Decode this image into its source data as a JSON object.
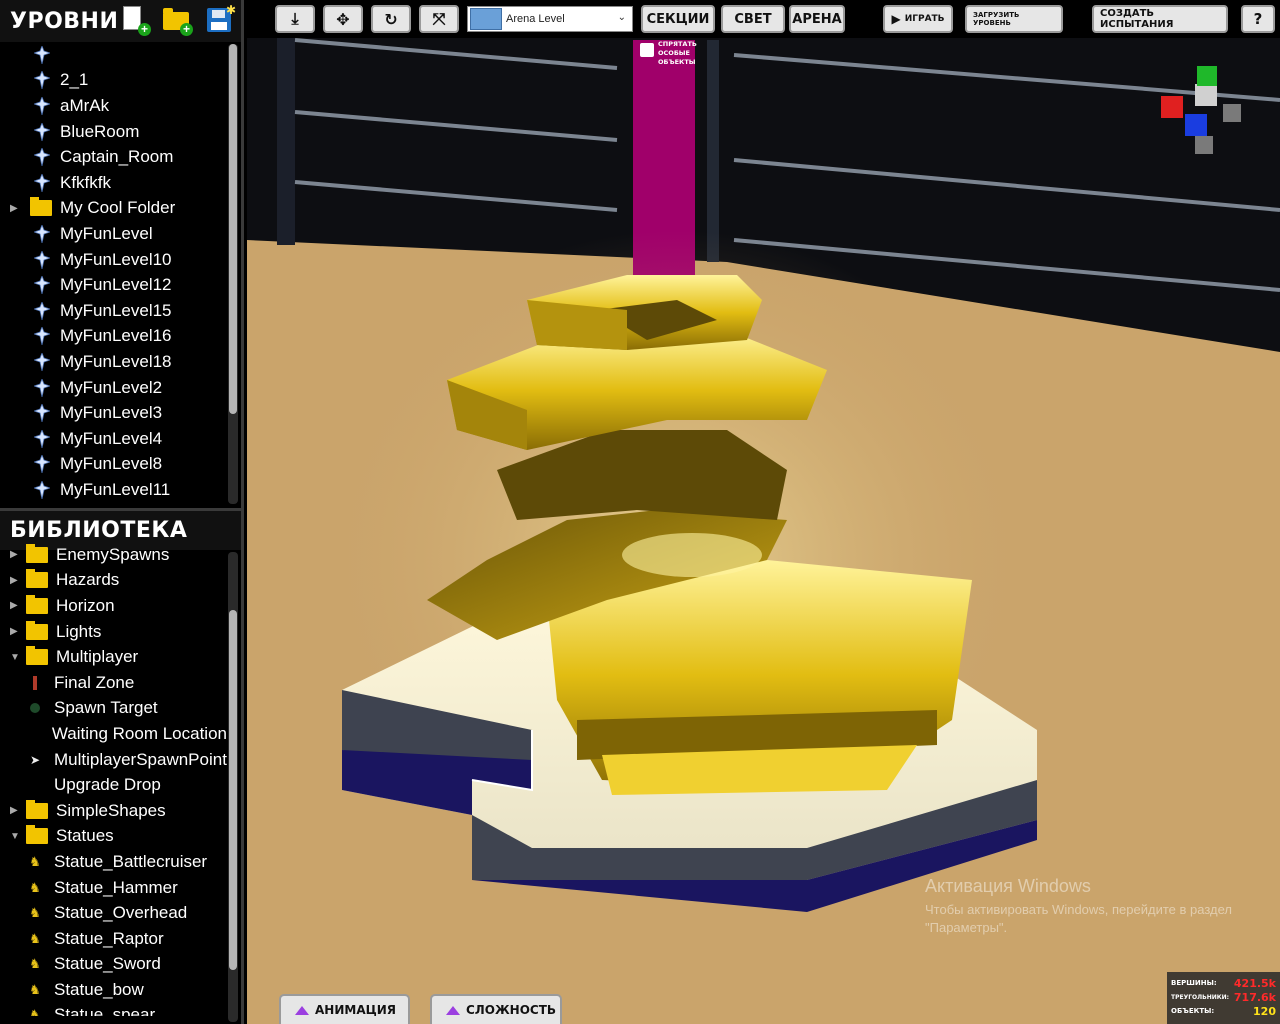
{
  "levels_panel": {
    "title": "УРОВНИ",
    "items": [
      {
        "type": "level",
        "label": ""
      },
      {
        "type": "level",
        "label": "2_1"
      },
      {
        "type": "level",
        "label": "aMrAk"
      },
      {
        "type": "level",
        "label": "BlueRoom"
      },
      {
        "type": "level",
        "label": "Captain_Room"
      },
      {
        "type": "level",
        "label": "Kfkfkfk"
      },
      {
        "type": "folder",
        "label": "My Cool Folder"
      },
      {
        "type": "level",
        "label": "MyFunLevel"
      },
      {
        "type": "level",
        "label": "MyFunLevel10"
      },
      {
        "type": "level",
        "label": "MyFunLevel12"
      },
      {
        "type": "level",
        "label": "MyFunLevel15"
      },
      {
        "type": "level",
        "label": "MyFunLevel16"
      },
      {
        "type": "level",
        "label": "MyFunLevel18"
      },
      {
        "type": "level",
        "label": "MyFunLevel2"
      },
      {
        "type": "level",
        "label": "MyFunLevel3"
      },
      {
        "type": "level",
        "label": "MyFunLevel4"
      },
      {
        "type": "level",
        "label": "MyFunLevel8"
      },
      {
        "type": "level",
        "label": "MyFunLevel11"
      }
    ]
  },
  "library_panel": {
    "title": "БИБЛИОТЕКА",
    "items": [
      {
        "type": "folder",
        "label": "EnemySpawns",
        "expanded": false
      },
      {
        "type": "folder",
        "label": "Hazards",
        "expanded": false
      },
      {
        "type": "folder",
        "label": "Horizon",
        "expanded": false
      },
      {
        "type": "folder",
        "label": "Lights",
        "expanded": false
      },
      {
        "type": "folder",
        "label": "Multiplayer",
        "expanded": true
      },
      {
        "type": "item",
        "label": "Final Zone",
        "icon": "red-pillar-icon"
      },
      {
        "type": "item",
        "label": "Spawn Target",
        "icon": "dark-sphere-icon"
      },
      {
        "type": "item",
        "label": "Waiting Room Location",
        "icon": ""
      },
      {
        "type": "item",
        "label": "MultiplayerSpawnPoint",
        "icon": "spawn-point-icon"
      },
      {
        "type": "item",
        "label": "Upgrade Drop",
        "icon": ""
      },
      {
        "type": "folder",
        "label": "SimpleShapes",
        "expanded": false
      },
      {
        "type": "folder",
        "label": "Statues",
        "expanded": true
      },
      {
        "type": "item",
        "label": "Statue_Battlecruiser",
        "icon": "statue-icon"
      },
      {
        "type": "item",
        "label": "Statue_Hammer",
        "icon": "statue-icon"
      },
      {
        "type": "item",
        "label": "Statue_Overhead",
        "icon": "statue-icon"
      },
      {
        "type": "item",
        "label": "Statue_Raptor",
        "icon": "statue-icon"
      },
      {
        "type": "item",
        "label": "Statue_Sword",
        "icon": "statue-icon"
      },
      {
        "type": "item",
        "label": "Statue_bow",
        "icon": "statue-icon"
      },
      {
        "type": "item",
        "label": "Statue_spear",
        "icon": "statue-icon"
      }
    ]
  },
  "toolbar": {
    "download_icon": "download-icon",
    "move_icon": "move-icon",
    "rotate_icon": "rotate-icon",
    "scale_icon": "scale-icon",
    "level_select_value": "Arena Level",
    "sections_label": "СЕКЦИИ",
    "light_label": "СВЕТ",
    "arena_label": "АРЕНА",
    "play_label": "ИГРАТЬ",
    "load_level_label": "ЗАГРУЗИТЬ УРОВЕНЬ",
    "create_challenge_label": "СОЗДАТЬ ИСПЫТАНИЯ",
    "help_label": "?"
  },
  "hide_special_objects_label": "СПРЯТАТЬ ОСОБЫЕ ОБЪЕКТЫ",
  "bottom_tabs": {
    "animation_label": "АНИМАЦИЯ",
    "difficulty_label": "СЛОЖНОСТЬ"
  },
  "stats": {
    "vertices_label": "ВЕРШИНЫ:",
    "vertices_value": "421.5k",
    "triangles_label": "ТРЕУГОЛЬНИКИ:",
    "triangles_value": "717.6k",
    "objects_label": "ОБЪЕКТЫ:",
    "objects_value": "120"
  },
  "watermark": {
    "title": "Активация Windows",
    "text": "Чтобы активировать Windows, перейдите в раздел \"Параметры\"."
  },
  "colors": {
    "accent_pillar": "#a0006a",
    "gold": "#e8c21a",
    "floor": "#caa46b",
    "stat_red": "#ff2a2a",
    "stat_yellow": "#ffe21a"
  }
}
